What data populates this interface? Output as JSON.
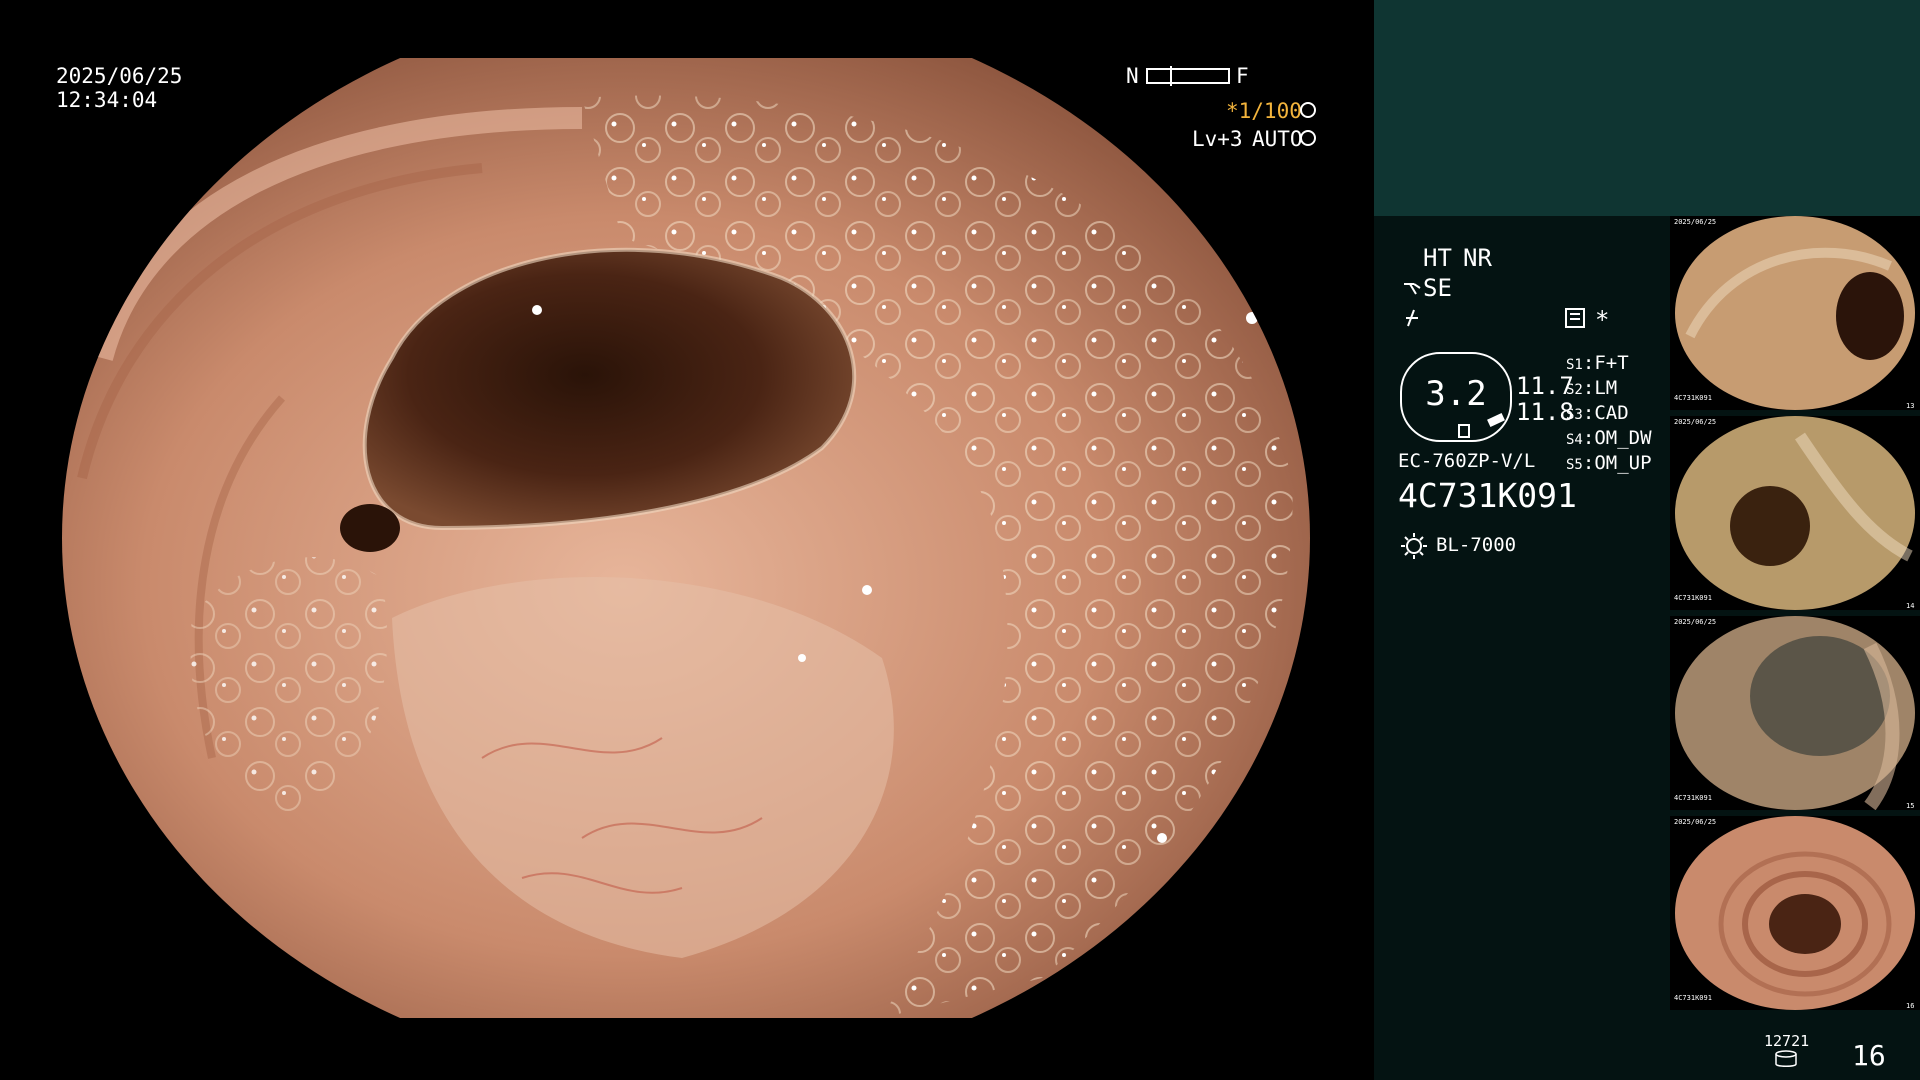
{
  "overlay": {
    "date": "2025/06/25",
    "time": "12:34:04",
    "near_label": "N",
    "far_label": "F",
    "shutter": "*1/100",
    "level": "Lv+3",
    "iris": "AUTO"
  },
  "panel": {
    "ht": "HT",
    "nr": "NR",
    "se": "SE",
    "record_marker": "*",
    "zoom_value": "3.2",
    "metric_top": "11.7",
    "metric_bottom": "11.8",
    "settings": [
      {
        "key": "S1",
        "value": "F+T"
      },
      {
        "key": "S2",
        "value": "LM"
      },
      {
        "key": "S3",
        "value": "CAD"
      },
      {
        "key": "S4",
        "value": "OM_DW"
      },
      {
        "key": "S5",
        "value": "OM_UP"
      }
    ],
    "scope_model": "EC-760ZP-V/L",
    "scope_serial": "4C731K091",
    "light_source": "BL-7000",
    "storage_count": "12721",
    "image_count": "16"
  },
  "thumbnails": [
    {
      "caption_top": "2025/06/25",
      "caption_id": "4C731K091",
      "number": "13"
    },
    {
      "caption_top": "2025/06/25",
      "caption_id": "4C731K091",
      "number": "14"
    },
    {
      "caption_top": "2025/06/25",
      "caption_id": "4C731K091",
      "number": "15"
    },
    {
      "caption_top": "2025/06/25",
      "caption_id": "4C731K091",
      "number": "16"
    }
  ],
  "colors": {
    "panel_bg": "#041312",
    "panel_top_bg": "#0f3532",
    "accent_yellow": "#f3b43c",
    "mucosa": "#c98a6c"
  }
}
